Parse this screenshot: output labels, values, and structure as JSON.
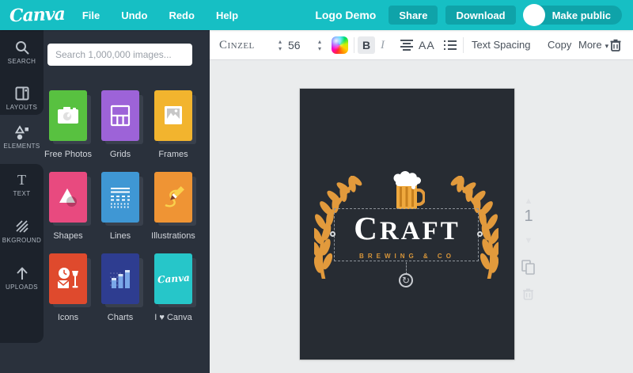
{
  "topbar": {
    "logo": "Canva",
    "menu": {
      "file": "File",
      "undo": "Undo",
      "redo": "Redo",
      "help": "Help"
    },
    "doc_title": "Logo Demo",
    "share_label": "Share",
    "download_label": "Download",
    "make_public_label": "Make public",
    "teal": "#16bfc4",
    "button_teal": "#0fa3a9"
  },
  "sidebar": {
    "items": [
      {
        "label": "SEARCH",
        "icon": "search-icon"
      },
      {
        "label": "LAYOUTS",
        "icon": "layouts-icon"
      },
      {
        "label": "ELEMENTS",
        "icon": "elements-icon",
        "selected": true
      },
      {
        "label": "TEXT",
        "icon": "text-icon"
      },
      {
        "label": "BKGROUND",
        "icon": "background-icon"
      },
      {
        "label": "UPLOADS",
        "icon": "uploads-icon"
      }
    ]
  },
  "panel": {
    "search_placeholder": "Search 1,000,000 images...",
    "tiles": [
      {
        "label": "Free Photos",
        "color": "#58c140",
        "icon": "camera-icon"
      },
      {
        "label": "Grids",
        "color": "#9d63d8",
        "icon": "grid-icon"
      },
      {
        "label": "Frames",
        "color": "#f2b42e",
        "icon": "frame-icon"
      },
      {
        "label": "Shapes",
        "color": "#e84a7f",
        "icon": "shapes-icon"
      },
      {
        "label": "Lines",
        "color": "#3f97d4",
        "icon": "lines-icon"
      },
      {
        "label": "Illustrations",
        "color": "#ef9434",
        "icon": "pencil-icon"
      },
      {
        "label": "Icons",
        "color": "#df4a2d",
        "icon": "pictogram-icon"
      },
      {
        "label": "Charts",
        "color": "#2e3d90",
        "icon": "bar-chart-icon"
      },
      {
        "label": "I ♥ Canva",
        "color": "#26c6c9",
        "icon": "canva-script-icon"
      }
    ]
  },
  "toolbar": {
    "font_name": "Cinzel",
    "font_size": "56",
    "bold_label": "B",
    "italic_label": "I",
    "uppercase_label": "AA",
    "text_spacing_label": "Text Spacing",
    "copy_label": "Copy",
    "more_label": "More",
    "caret": "▾",
    "stepper_up": "▴",
    "stepper_down": "▾"
  },
  "canvas": {
    "title": "CRAFT",
    "subtitle": "BREWING & CO",
    "bg": "#272c33",
    "accent": "#e29a3c",
    "rotate_glyph": "↻"
  },
  "page_rail": {
    "page_number": "1"
  }
}
